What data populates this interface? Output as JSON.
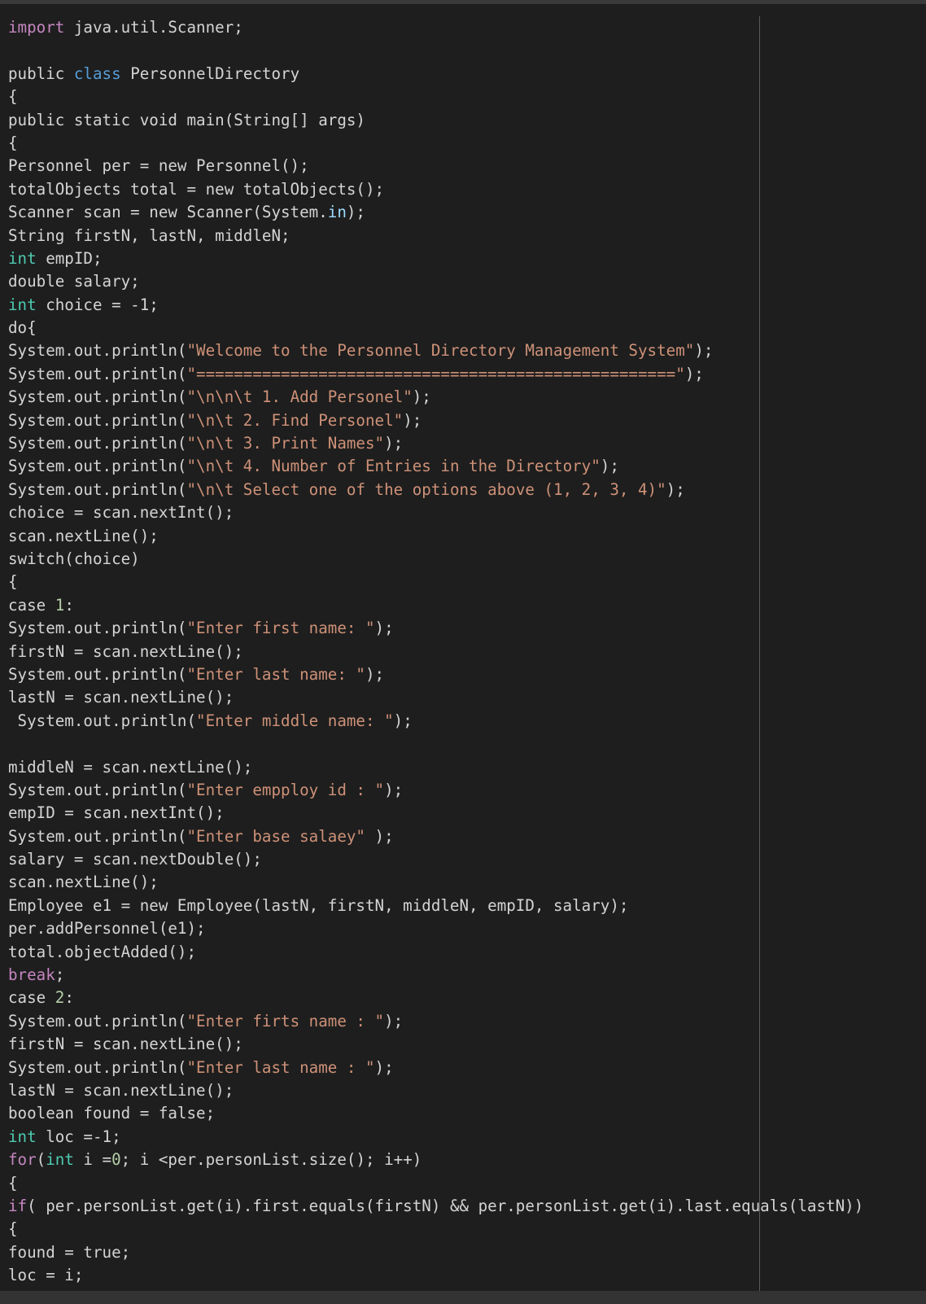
{
  "editor": {
    "language": "java",
    "lines": [
      {
        "tokens": [
          {
            "t": "import",
            "c": "kw-purple"
          },
          {
            "t": " java.util.Scanner;"
          }
        ]
      },
      {
        "tokens": []
      },
      {
        "tokens": [
          {
            "t": "public "
          },
          {
            "t": "class",
            "c": "kw-blue"
          },
          {
            "t": " PersonnelDirectory"
          }
        ]
      },
      {
        "tokens": [
          {
            "t": "{"
          }
        ]
      },
      {
        "tokens": [
          {
            "t": "public static void main(String[] args)"
          }
        ]
      },
      {
        "tokens": [
          {
            "t": "{"
          }
        ]
      },
      {
        "tokens": [
          {
            "t": "Personnel per = new Personnel();"
          }
        ]
      },
      {
        "tokens": [
          {
            "t": "totalObjects total = new totalObjects();"
          }
        ]
      },
      {
        "tokens": [
          {
            "t": "Scanner scan = new Scanner(System."
          },
          {
            "t": "in",
            "c": "field"
          },
          {
            "t": ");"
          }
        ]
      },
      {
        "tokens": [
          {
            "t": "String firstN, lastN, middleN;"
          }
        ]
      },
      {
        "tokens": [
          {
            "t": "int",
            "c": "kw-teal"
          },
          {
            "t": " empID;"
          }
        ]
      },
      {
        "tokens": [
          {
            "t": "double salary;"
          }
        ]
      },
      {
        "tokens": [
          {
            "t": "int",
            "c": "kw-teal"
          },
          {
            "t": " choice = -1;"
          }
        ]
      },
      {
        "tokens": [
          {
            "t": "do{"
          }
        ]
      },
      {
        "tokens": [
          {
            "t": "System.out.println("
          },
          {
            "t": "\"Welcome to the Personnel Directory Management System\"",
            "c": "str"
          },
          {
            "t": ");"
          }
        ]
      },
      {
        "tokens": [
          {
            "t": "System.out.println("
          },
          {
            "t": "\"===================================================\"",
            "c": "str"
          },
          {
            "t": ");"
          }
        ]
      },
      {
        "tokens": [
          {
            "t": "System.out.println("
          },
          {
            "t": "\"\\n\\n\\t 1. Add Personel\"",
            "c": "str"
          },
          {
            "t": ");"
          }
        ]
      },
      {
        "tokens": [
          {
            "t": "System.out.println("
          },
          {
            "t": "\"\\n\\t 2. Find Personel\"",
            "c": "str"
          },
          {
            "t": ");"
          }
        ]
      },
      {
        "tokens": [
          {
            "t": "System.out.println("
          },
          {
            "t": "\"\\n\\t 3. Print Names\"",
            "c": "str"
          },
          {
            "t": ");"
          }
        ]
      },
      {
        "tokens": [
          {
            "t": "System.out.println("
          },
          {
            "t": "\"\\n\\t 4. Number of Entries in the Directory\"",
            "c": "str"
          },
          {
            "t": ");"
          }
        ]
      },
      {
        "tokens": [
          {
            "t": "System.out.println("
          },
          {
            "t": "\"\\n\\t Select one of the options above (1, 2, 3, 4)\"",
            "c": "str"
          },
          {
            "t": ");"
          }
        ]
      },
      {
        "tokens": [
          {
            "t": "choice = scan.nextInt();"
          }
        ]
      },
      {
        "tokens": [
          {
            "t": "scan.nextLine();"
          }
        ]
      },
      {
        "tokens": [
          {
            "t": "switch(choice)"
          }
        ]
      },
      {
        "tokens": [
          {
            "t": "{"
          }
        ]
      },
      {
        "tokens": [
          {
            "t": "case "
          },
          {
            "t": "1",
            "c": "num"
          },
          {
            "t": ":"
          }
        ]
      },
      {
        "tokens": [
          {
            "t": "System.out.println("
          },
          {
            "t": "\"Enter first name: \"",
            "c": "str"
          },
          {
            "t": ");"
          }
        ]
      },
      {
        "tokens": [
          {
            "t": "firstN = scan.nextLine();"
          }
        ]
      },
      {
        "tokens": [
          {
            "t": "System.out.println("
          },
          {
            "t": "\"Enter last name: \"",
            "c": "str"
          },
          {
            "t": ");"
          }
        ]
      },
      {
        "tokens": [
          {
            "t": "lastN = scan.nextLine();"
          }
        ]
      },
      {
        "tokens": [
          {
            "t": " System.out.println("
          },
          {
            "t": "\"Enter middle name: \"",
            "c": "str"
          },
          {
            "t": ");"
          }
        ]
      },
      {
        "tokens": []
      },
      {
        "tokens": [
          {
            "t": "middleN = scan.nextLine();"
          }
        ]
      },
      {
        "tokens": [
          {
            "t": "System.out.println("
          },
          {
            "t": "\"Enter empploy id : \"",
            "c": "str"
          },
          {
            "t": ");"
          }
        ]
      },
      {
        "tokens": [
          {
            "t": "empID = scan.nextInt();"
          }
        ]
      },
      {
        "tokens": [
          {
            "t": "System.out.println("
          },
          {
            "t": "\"Enter base salaey\"",
            "c": "str"
          },
          {
            "t": " );"
          }
        ]
      },
      {
        "tokens": [
          {
            "t": "salary = scan.nextDouble();"
          }
        ]
      },
      {
        "tokens": [
          {
            "t": "scan.nextLine();"
          }
        ]
      },
      {
        "tokens": [
          {
            "t": "Employee e1 = new Employee(lastN, firstN, middleN, empID, salary);"
          }
        ]
      },
      {
        "tokens": [
          {
            "t": "per.addPersonnel(e1);"
          }
        ]
      },
      {
        "tokens": [
          {
            "t": "total.objectAdded();"
          }
        ]
      },
      {
        "tokens": [
          {
            "t": "break",
            "c": "kw-purple"
          },
          {
            "t": ";"
          }
        ]
      },
      {
        "tokens": [
          {
            "t": "case "
          },
          {
            "t": "2",
            "c": "num"
          },
          {
            "t": ":"
          }
        ]
      },
      {
        "tokens": [
          {
            "t": "System.out.println("
          },
          {
            "t": "\"Enter firts name : \"",
            "c": "str"
          },
          {
            "t": ");"
          }
        ]
      },
      {
        "tokens": [
          {
            "t": "firstN = scan.nextLine();"
          }
        ]
      },
      {
        "tokens": [
          {
            "t": "System.out.println("
          },
          {
            "t": "\"Enter last name : \"",
            "c": "str"
          },
          {
            "t": ");"
          }
        ]
      },
      {
        "tokens": [
          {
            "t": "lastN = scan.nextLine();"
          }
        ]
      },
      {
        "tokens": [
          {
            "t": "boolean found = false;"
          }
        ]
      },
      {
        "tokens": [
          {
            "t": "int",
            "c": "kw-teal"
          },
          {
            "t": " loc =-1;"
          }
        ]
      },
      {
        "tokens": [
          {
            "t": "for",
            "c": "kw-purple"
          },
          {
            "t": "("
          },
          {
            "t": "int",
            "c": "kw-teal"
          },
          {
            "t": " i ="
          },
          {
            "t": "0",
            "c": "num"
          },
          {
            "t": "; i <per.personList.size(); i++)"
          }
        ]
      },
      {
        "tokens": [
          {
            "t": "{"
          }
        ]
      },
      {
        "tokens": [
          {
            "t": "if",
            "c": "kw-purple"
          },
          {
            "t": "( per.personList.get(i).first.equals(firstN) && per.personList.get(i).last.equals(lastN))"
          }
        ]
      },
      {
        "tokens": [
          {
            "t": "{"
          }
        ]
      },
      {
        "tokens": [
          {
            "t": "found = true;"
          }
        ]
      },
      {
        "tokens": [
          {
            "t": "loc = i;"
          }
        ]
      }
    ]
  }
}
